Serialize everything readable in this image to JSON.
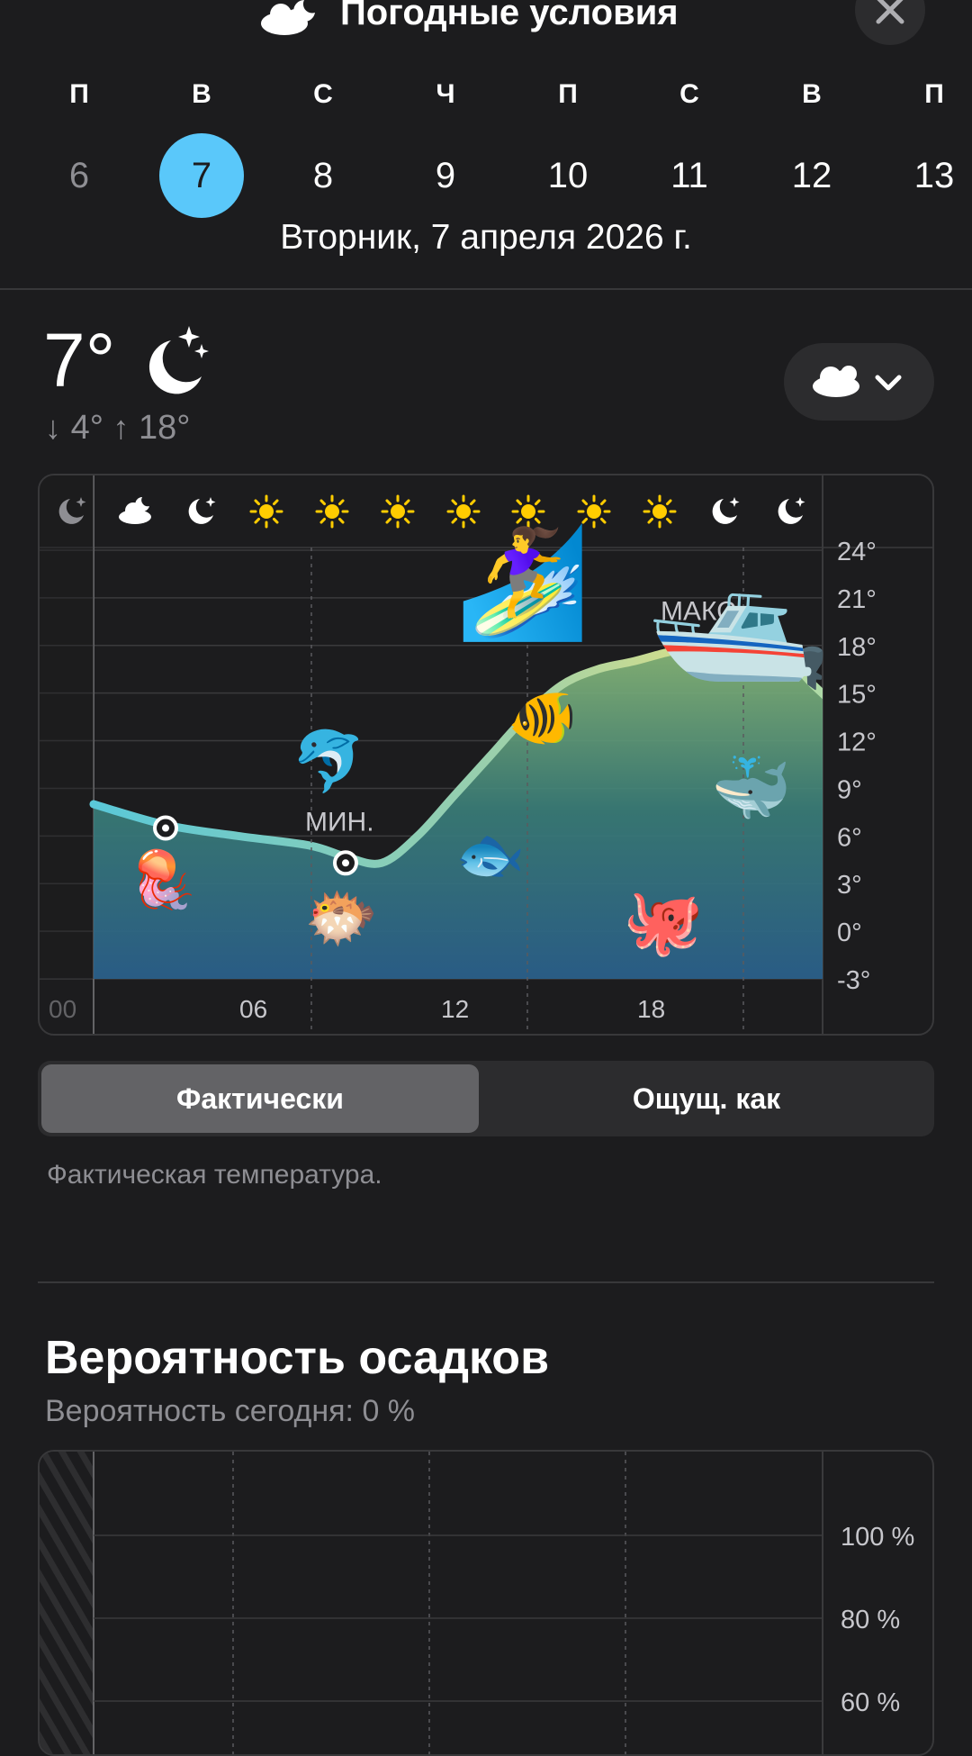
{
  "header": {
    "title": "Погодные условия",
    "icon": "cloud-moon-icon",
    "close_icon": "close-icon"
  },
  "week": [
    {
      "letter": "П",
      "day": "6",
      "state": "past"
    },
    {
      "letter": "В",
      "day": "7",
      "state": "selected"
    },
    {
      "letter": "С",
      "day": "8",
      "state": "future"
    },
    {
      "letter": "Ч",
      "day": "9",
      "state": "future"
    },
    {
      "letter": "П",
      "day": "10",
      "state": "future"
    },
    {
      "letter": "С",
      "day": "11",
      "state": "future"
    },
    {
      "letter": "В",
      "day": "12",
      "state": "future"
    },
    {
      "letter": "П",
      "day": "13",
      "state": "future"
    }
  ],
  "selected_date": "Вторник, 7 апреля 2026 г.",
  "current": {
    "temp": "7°",
    "icon": "moon-stars-icon",
    "low": "4°",
    "high": "18°",
    "condition_menu_icon": "cloud-icon"
  },
  "chart_data": {
    "type": "area",
    "hour_icons": [
      "moon-icon",
      "cloud-moon-icon",
      "moon-icon",
      "sun-icon",
      "sun-icon",
      "sun-icon",
      "sun-icon",
      "sun-icon",
      "sun-icon",
      "sun-icon",
      "moon-icon",
      "moon-icon"
    ],
    "x_ticks": [
      "00",
      "06",
      "12",
      "18"
    ],
    "y_ticks": [
      "24°",
      "21°",
      "18°",
      "15°",
      "12°",
      "9°",
      "6°",
      "3°",
      "0°",
      "-3°"
    ],
    "ylim": [
      -3,
      24
    ],
    "x_hours": [
      0,
      2,
      4,
      6,
      7,
      8,
      9,
      10,
      11,
      12,
      13,
      14,
      15,
      16,
      17,
      18,
      19,
      20,
      21,
      22,
      23,
      24
    ],
    "temps": [
      8,
      6.7,
      6,
      5.4,
      4.7,
      4.3,
      6,
      8.5,
      11,
      13.5,
      15.5,
      16.5,
      17,
      17.6,
      18,
      18.2,
      17.8,
      15.5,
      13.5,
      12,
      11,
      9.5
    ],
    "min_label": "МИН.",
    "max_label": "МАКС.",
    "min_point": {
      "hour": 7,
      "temp": 4.3
    },
    "max_point": {
      "hour": 17,
      "temp": 17.8
    },
    "emoji": [
      "🪼",
      "🐬",
      "🐡",
      "🏄‍♀️",
      "🐠",
      "🐟",
      "🛥️",
      "🐳",
      "🐙"
    ]
  },
  "segmented": {
    "actual": "Фактически",
    "feels": "Ощущ. как"
  },
  "description": "Фактическая температура.",
  "precip": {
    "title": "Вероятность осадков",
    "subtitle": "Вероятность сегодня: 0 %",
    "y_ticks": [
      "100 %",
      "80 %",
      "60 %"
    ]
  },
  "colors": {
    "accent": "#5ac8fa",
    "background": "#1c1c1e",
    "secondary_text": "#8e8e93",
    "sun": "#ffcc00"
  }
}
